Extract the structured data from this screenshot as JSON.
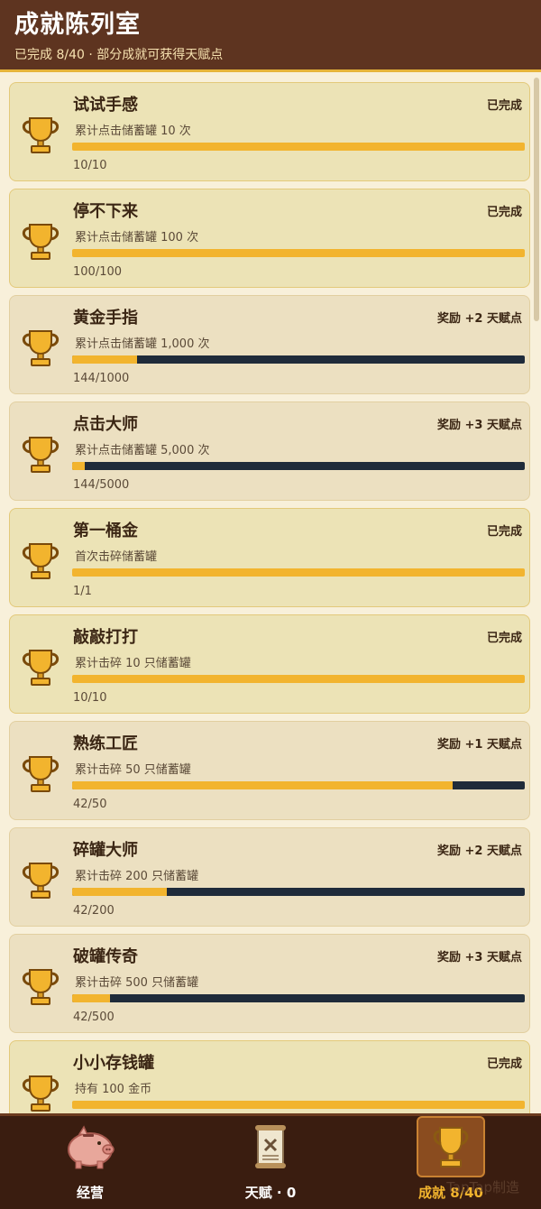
{
  "header": {
    "title": "成就陈列室",
    "subtitle": "已完成 8/40 · 部分成就可获得天赋点"
  },
  "colors": {
    "header_bg": "#5e3420",
    "accent_gold": "#f2b42e",
    "bar_track": "#1f2b3a",
    "card_done": "#ece3b6",
    "card_pending": "#ece0c1",
    "nav_bg": "#3a1d10"
  },
  "achievements": [
    {
      "name": "试试手感",
      "status": "已完成",
      "desc": "累计点击储蓄罐 10 次",
      "progress": "10/10",
      "ratio": 1.0,
      "done": true
    },
    {
      "name": "停不下来",
      "status": "已完成",
      "desc": "累计点击储蓄罐 100 次",
      "progress": "100/100",
      "ratio": 1.0,
      "done": true
    },
    {
      "name": "黄金手指",
      "status": "奖励 +2 天赋点",
      "desc": "累计点击储蓄罐 1,000 次",
      "progress": "144/1000",
      "ratio": 0.144,
      "done": false
    },
    {
      "name": "点击大师",
      "status": "奖励 +3 天赋点",
      "desc": "累计点击储蓄罐 5,000 次",
      "progress": "144/5000",
      "ratio": 0.0288,
      "done": false
    },
    {
      "name": "第一桶金",
      "status": "已完成",
      "desc": "首次击碎储蓄罐",
      "progress": "1/1",
      "ratio": 1.0,
      "done": true
    },
    {
      "name": "敲敲打打",
      "status": "已完成",
      "desc": "累计击碎 10 只储蓄罐",
      "progress": "10/10",
      "ratio": 1.0,
      "done": true
    },
    {
      "name": "熟练工匠",
      "status": "奖励 +1 天赋点",
      "desc": "累计击碎 50 只储蓄罐",
      "progress": "42/50",
      "ratio": 0.84,
      "done": false
    },
    {
      "name": "碎罐大师",
      "status": "奖励 +2 天赋点",
      "desc": "累计击碎 200 只储蓄罐",
      "progress": "42/200",
      "ratio": 0.21,
      "done": false
    },
    {
      "name": "破罐传奇",
      "status": "奖励 +3 天赋点",
      "desc": "累计击碎 500 只储蓄罐",
      "progress": "42/500",
      "ratio": 0.084,
      "done": false
    },
    {
      "name": "小小存钱罐",
      "status": "已完成",
      "desc": "持有 100 金币",
      "progress": "",
      "ratio": 1.0,
      "done": true
    }
  ],
  "nav": {
    "items": [
      {
        "label": "经营",
        "icon": "piggy-bank-icon"
      },
      {
        "label": "天赋 · 0",
        "icon": "scroll-icon"
      },
      {
        "label": "成就 8/40",
        "icon": "trophy-icon",
        "active": true
      }
    ]
  },
  "watermark": "TapTap制造"
}
